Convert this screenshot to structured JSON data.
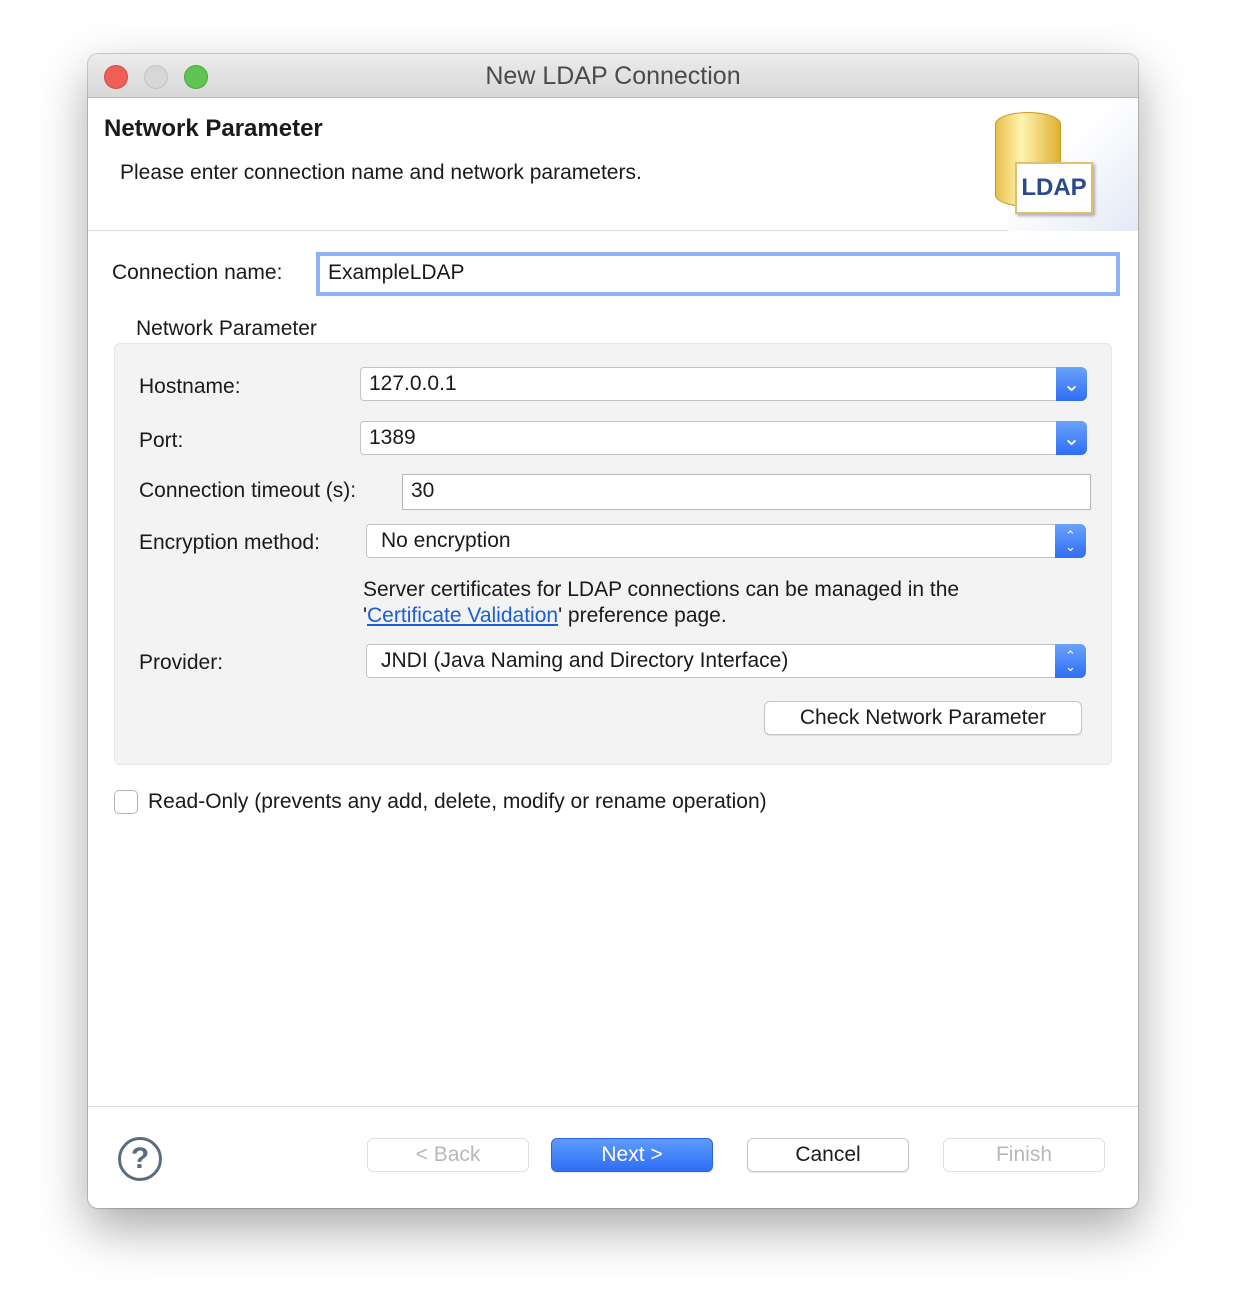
{
  "window": {
    "title": "New LDAP Connection"
  },
  "header": {
    "title": "Network Parameter",
    "description": "Please enter connection name and network parameters.",
    "logo_text": "LDAP",
    "logo_icon": "ldap-database-icon"
  },
  "connection_name": {
    "label": "Connection name:",
    "value": "ExampleLDAP"
  },
  "network": {
    "group_label": "Network Parameter",
    "hostname": {
      "label": "Hostname:",
      "value": "127.0.0.1"
    },
    "port": {
      "label": "Port:",
      "value": "1389"
    },
    "timeout": {
      "label": "Connection timeout (s):",
      "value": "30"
    },
    "encryption": {
      "label": "Encryption method:",
      "value": "No encryption"
    },
    "cert_note_1": "Server certificates for LDAP connections can be managed in the",
    "cert_note_q1": "'",
    "cert_link": "Certificate Validation",
    "cert_note_2": "' preference page.",
    "provider": {
      "label": "Provider:",
      "value": "JNDI (Java Naming and Directory Interface)"
    },
    "check_button": "Check Network Parameter"
  },
  "read_only": {
    "label": "Read-Only (prevents any add, delete, modify or rename operation)",
    "checked": false
  },
  "footer": {
    "help_icon": "help-icon",
    "back": "< Back",
    "next": "Next >",
    "cancel": "Cancel",
    "finish": "Finish"
  },
  "colors": {
    "accent": "#2e6ef5",
    "link": "#1a5fd6",
    "close": "#ee5f58",
    "zoom": "#5fc453"
  }
}
